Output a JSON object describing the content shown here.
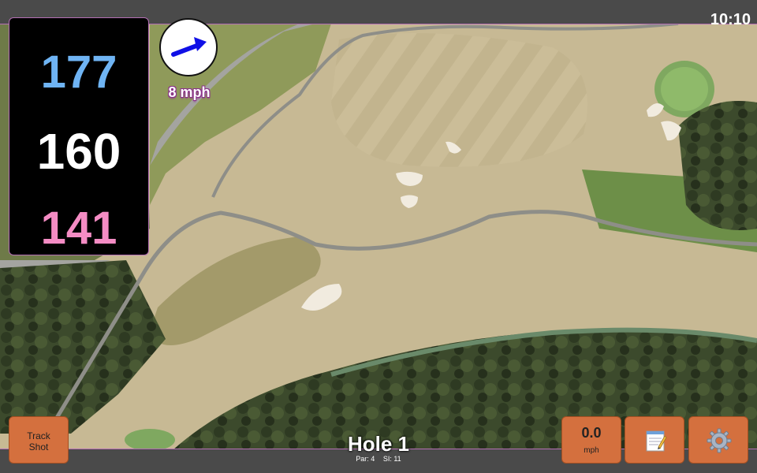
{
  "status": {
    "clock": "10:10"
  },
  "distances": {
    "back": "177",
    "center": "160",
    "front": "141"
  },
  "wind": {
    "speed_label": "8 mph"
  },
  "hole": {
    "title": "Hole 1",
    "par": "Par: 4",
    "si": "SI: 11"
  },
  "buttons": {
    "track_shot_line1": "Track",
    "track_shot_line2": "Shot",
    "speed_value": "0.0",
    "speed_unit": "mph"
  },
  "icons": {
    "wind": "arrow-icon",
    "notes": "notepad-icon",
    "settings": "gear-icon"
  },
  "colors": {
    "back_distance": "#6fb4f4",
    "center_distance": "#ffffff",
    "front_distance": "#f48cc4",
    "button": "#d4703e",
    "wind_label_outline": "#8b2f8b"
  }
}
